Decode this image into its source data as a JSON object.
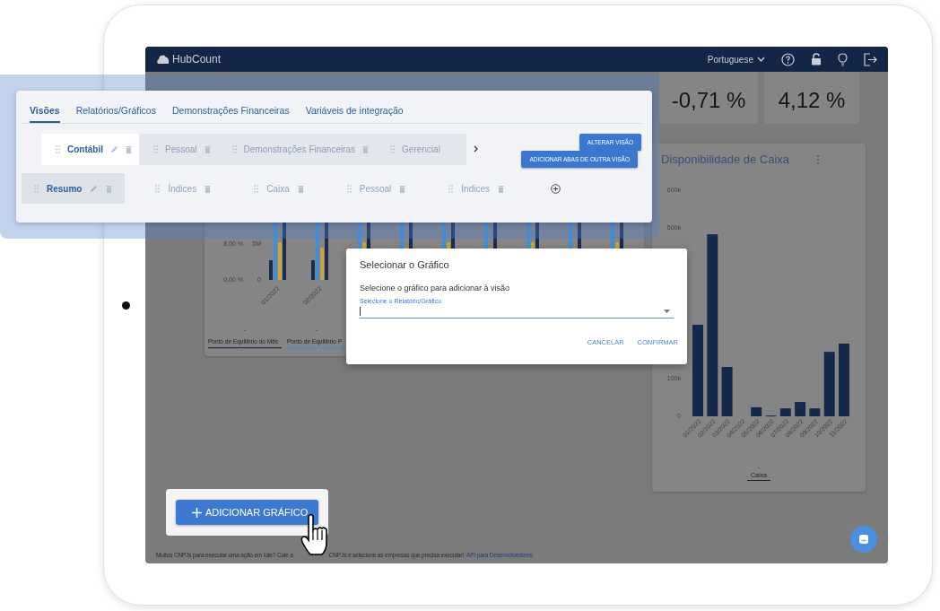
{
  "navbar": {
    "logo": "HubCount",
    "language": "Portuguese"
  },
  "kpis": [
    {
      "value": "-0,71 %"
    },
    {
      "value": "4,12 %"
    }
  ],
  "left_chart": {
    "y_left_ticks": [
      "8,00 %",
      "0,00 %"
    ],
    "y_right_ticks": [
      "5M",
      "0"
    ],
    "x_labels": [
      "01/2022",
      "02/2022"
    ],
    "legend": [
      {
        "marker": "-",
        "label": "Ponto de Equilíbrio do Mês",
        "color": "#1b2c4c"
      },
      {
        "marker": "-",
        "label": "Ponto de Equilíbrio P",
        "color": "#3f8fd8"
      }
    ]
  },
  "cash_card": {
    "legend_marker": "-",
    "chart_data": {
      "type": "bar",
      "title": "Disponibilidade de Caixa",
      "categories": [
        "01/2022",
        "02/2022",
        "03/2022",
        "04/2022",
        "05/2022",
        "06/2022",
        "07/2022",
        "08/2022",
        "09/2022",
        "10/2022",
        "11/2022"
      ],
      "series": [
        {
          "name": "Caixa",
          "color": "#15294a",
          "values": [
            243000,
            483000,
            131000,
            0,
            24000,
            2000,
            21000,
            38000,
            21000,
            171000,
            193000
          ]
        }
      ],
      "ylim": [
        0,
        600000
      ],
      "yticks": [
        {
          "value": 0,
          "label": "0"
        },
        {
          "value": 100000,
          "label": "100k"
        },
        {
          "value": 500000,
          "label": "500k"
        },
        {
          "value": 600000,
          "label": "600k"
        }
      ]
    }
  },
  "view_panel": {
    "tabs": [
      {
        "label": "Visões",
        "selected": true
      },
      {
        "label": "Relatórios/Gráficos",
        "selected": false
      },
      {
        "label": "Demonstrações Financeiras",
        "selected": false
      },
      {
        "label": "Variáveis de integração",
        "selected": false
      }
    ],
    "views": [
      {
        "label": "Contábil",
        "selected": true
      },
      {
        "label": "Pessoal",
        "selected": false
      },
      {
        "label": "Demonstrações Financeiras",
        "selected": false
      },
      {
        "label": "Gerencial",
        "selected": false
      }
    ],
    "buttons": [
      "ALTERAR VISÃO",
      "ADICIONAR ABAS DE OUTRA VISÃO"
    ],
    "sheets": [
      {
        "label": "Resumo",
        "selected": true
      },
      {
        "label": "Índices",
        "selected": false
      },
      {
        "label": "Caixa",
        "selected": false
      },
      {
        "label": "Pessoal",
        "selected": false
      },
      {
        "label": "Índices",
        "selected": false
      }
    ]
  },
  "dialog": {
    "title": "Selecionar o Gráfico",
    "message": "Selecione o gráfico para adicionar à visão",
    "field_label": "Selecione o Relatório/Gráfico",
    "buttons": [
      "CANCELAR",
      "CONFIRMAR"
    ]
  },
  "add_button": "ADICIONAR GRÁFICO",
  "footer": {
    "text_before": "Muitos CNPJs para executar uma ação em lote? Cole a",
    "text_after": "CNPJs e selecione as empresas que precisa executar!",
    "link": "API para Desenvolvedores"
  }
}
